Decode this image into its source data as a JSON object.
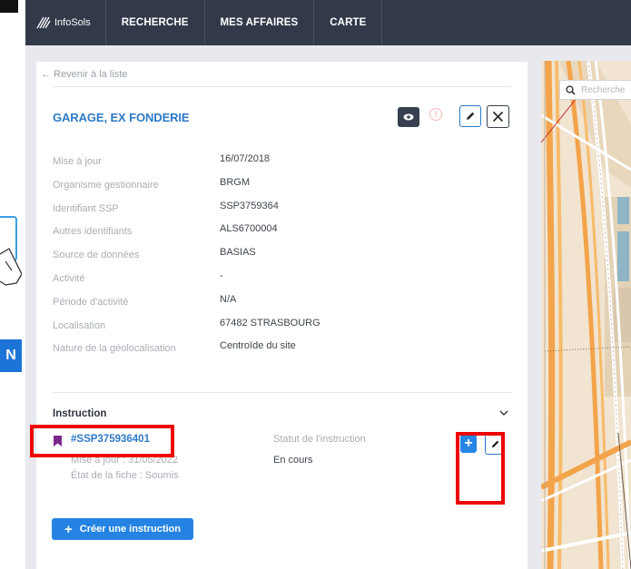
{
  "navbar": {
    "brand": "InfoSols",
    "items": [
      "RECHERCHE",
      "MES AFFAIRES",
      "CARTE"
    ]
  },
  "side_tab": {
    "label": "N"
  },
  "panel": {
    "back_link": "← Revenir à la liste",
    "title": "GARAGE, EX FONDERIE",
    "fields": [
      {
        "label": "Mise à jour",
        "value": "16/07/2018"
      },
      {
        "label": "Organisme gestionnaire",
        "value": "BRGM"
      },
      {
        "label": "Identifiant SSP",
        "value": "SSP3759364"
      },
      {
        "label": "Autres identifiants",
        "value": "ALS6700004"
      },
      {
        "label": "Source de données",
        "value": "BASIAS"
      },
      {
        "label": "Activité",
        "value": "-"
      },
      {
        "label": "Période d'activité",
        "value": "N/A"
      },
      {
        "label": "Localisation",
        "value": "67482 STRASBOURG"
      },
      {
        "label": "Nature de la géolocalisation",
        "value": "Centroïde du site"
      }
    ],
    "instruction": {
      "heading": "Instruction",
      "id": "#SSP375936401",
      "updated": "Mise à jour : 31/05/2022",
      "state": "État de la fiche : Soumis",
      "status_label": "Statut de l'instruction",
      "status_value": "En cours"
    },
    "create_button": "Créer une instruction"
  },
  "map": {
    "search_placeholder": "Recherche"
  },
  "colors": {
    "navbar": "#323a4a",
    "accent": "#2d79c9",
    "annotation": "#ee0000",
    "bookmark": "#7a2a8a"
  }
}
